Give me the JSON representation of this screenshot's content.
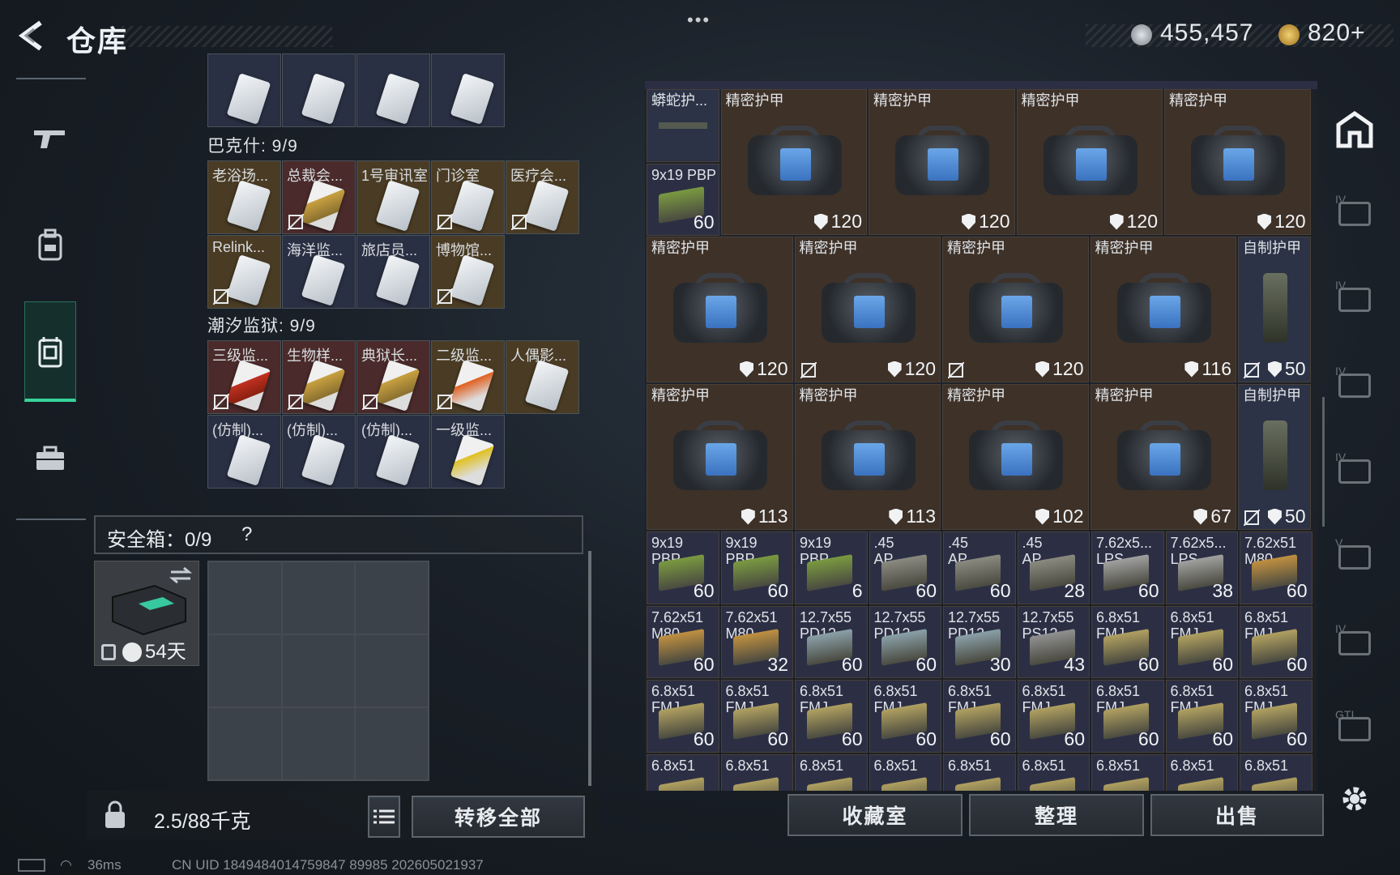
{
  "header": {
    "title": "仓库",
    "menu_dots": "•••",
    "currency1": "455,457",
    "currency2": "820+"
  },
  "left_nav": {
    "items": [
      "weapon-icon",
      "backpack-icon",
      "vest-icon",
      "briefcase-icon"
    ]
  },
  "keycards": {
    "top_row": [
      {
        "label": "",
        "color": "blue"
      },
      {
        "label": "",
        "color": "blue"
      },
      {
        "label": "",
        "color": "blue"
      },
      {
        "label": "",
        "color": "blue"
      }
    ],
    "section1": {
      "title": "巴克什: 9/9",
      "items": [
        {
          "label": "老浴场...",
          "bg": "gold",
          "card": "white",
          "locked": false
        },
        {
          "label": "总裁会...",
          "bg": "red",
          "card": "gold",
          "locked": true
        },
        {
          "label": "1号审讯室",
          "bg": "gold",
          "card": "white",
          "locked": false
        },
        {
          "label": "门诊室",
          "bg": "gold",
          "card": "white",
          "locked": true
        },
        {
          "label": "医疗会...",
          "bg": "gold",
          "card": "white",
          "locked": true
        },
        {
          "label": "Relink...",
          "bg": "gold",
          "card": "white",
          "locked": true
        },
        {
          "label": "海洋监...",
          "bg": "blue",
          "card": "white",
          "locked": false
        },
        {
          "label": "旅店员...",
          "bg": "blue",
          "card": "white",
          "locked": false
        },
        {
          "label": "博物馆...",
          "bg": "gold",
          "card": "white",
          "locked": true
        }
      ]
    },
    "section2": {
      "title": "潮汐监狱: 9/9",
      "items": [
        {
          "label": "三级监...",
          "bg": "red",
          "card": "red",
          "locked": true
        },
        {
          "label": "生物样...",
          "bg": "red",
          "card": "gold",
          "locked": true
        },
        {
          "label": "典狱长...",
          "bg": "red",
          "card": "gold",
          "locked": true
        },
        {
          "label": "二级监...",
          "bg": "gold",
          "card": "orange",
          "locked": true
        },
        {
          "label": "人偶影...",
          "bg": "gold",
          "card": "white",
          "locked": false
        },
        {
          "label": "(仿制)...",
          "bg": "blue",
          "card": "white",
          "locked": false
        },
        {
          "label": "(仿制)...",
          "bg": "blue",
          "card": "white",
          "locked": false
        },
        {
          "label": "(仿制)...",
          "bg": "blue",
          "card": "white",
          "locked": false
        },
        {
          "label": "一级监...",
          "bg": "blue",
          "card": "yellow",
          "locked": false
        }
      ]
    }
  },
  "safebox": {
    "label": "安全箱：0/9",
    "help": "?",
    "days": "54天"
  },
  "bottom_left": {
    "weight": "2.5/88千克",
    "transfer_all": "转移全部"
  },
  "inventory": {
    "row1": [
      {
        "name": "蟒蛇护...",
        "type": "rig"
      },
      {
        "name": "精密护甲",
        "dur": "120"
      },
      {
        "name": "精密护甲",
        "dur": "120"
      },
      {
        "name": "精密护甲",
        "dur": "120"
      },
      {
        "name": "精密护甲",
        "dur": "120"
      }
    ],
    "row1_ammo": {
      "name": "9x19 PBP",
      "qty": "60"
    },
    "row2": [
      {
        "name": "精密护甲",
        "dur": "120",
        "lock": false
      },
      {
        "name": "精密护甲",
        "dur": "120",
        "lock": true
      },
      {
        "name": "精密护甲",
        "dur": "120",
        "lock": true
      },
      {
        "name": "精密护甲",
        "dur": "116",
        "lock": false
      },
      {
        "name": "自制护甲",
        "dur": "50",
        "lock": true
      }
    ],
    "row3": [
      {
        "name": "精密护甲",
        "dur": "113",
        "lock": false
      },
      {
        "name": "精密护甲",
        "dur": "113",
        "lock": false
      },
      {
        "name": "精密护甲",
        "dur": "102",
        "lock": false
      },
      {
        "name": "精密护甲",
        "dur": "67",
        "lock": false
      },
      {
        "name": "自制护甲",
        "dur": "50",
        "lock": true
      }
    ],
    "ammo_rows": [
      [
        {
          "n1": "9x19",
          "n2": "PBP",
          "q": "60",
          "c": "#7a9a40"
        },
        {
          "n1": "9x19",
          "n2": "PBP",
          "q": "60",
          "c": "#7a9a40"
        },
        {
          "n1": "9x19",
          "n2": "PBP",
          "q": "6",
          "c": "#7a9a40"
        },
        {
          "n1": ".45",
          "n2": "AP",
          "q": "60",
          "c": "#8a8a80"
        },
        {
          "n1": ".45",
          "n2": "AP",
          "q": "60",
          "c": "#8a8a80"
        },
        {
          "n1": ".45",
          "n2": "AP",
          "q": "28",
          "c": "#8a8a80"
        },
        {
          "n1": "7.62x5...",
          "n2": "LPS",
          "q": "60",
          "c": "#a0a0a0"
        },
        {
          "n1": "7.62x5...",
          "n2": "LPS",
          "q": "38",
          "c": "#a0a0a0"
        },
        {
          "n1": "7.62x51",
          "n2": "M80",
          "q": "60",
          "c": "#c09040"
        }
      ],
      [
        {
          "n1": "7.62x51",
          "n2": "M80",
          "q": "60",
          "c": "#c09040"
        },
        {
          "n1": "7.62x51",
          "n2": "M80",
          "q": "32",
          "c": "#c09040"
        },
        {
          "n1": "12.7x55",
          "n2": "PD12",
          "q": "60",
          "c": "#8aa0a8"
        },
        {
          "n1": "12.7x55",
          "n2": "PD12",
          "q": "60",
          "c": "#8aa0a8"
        },
        {
          "n1": "12.7x55",
          "n2": "PD12",
          "q": "30",
          "c": "#8aa0a8"
        },
        {
          "n1": "12.7x55",
          "n2": "PS12",
          "q": "43",
          "c": "#909090"
        },
        {
          "n1": "6.8x51",
          "n2": "FMJ",
          "q": "60",
          "c": "#b0a060"
        },
        {
          "n1": "6.8x51",
          "n2": "FMJ",
          "q": "60",
          "c": "#b0a060"
        },
        {
          "n1": "6.8x51",
          "n2": "FMJ",
          "q": "60",
          "c": "#b0a060"
        }
      ],
      [
        {
          "n1": "6.8x51",
          "n2": "FMJ",
          "q": "60",
          "c": "#b0a060"
        },
        {
          "n1": "6.8x51",
          "n2": "FMJ",
          "q": "60",
          "c": "#b0a060"
        },
        {
          "n1": "6.8x51",
          "n2": "FMJ",
          "q": "60",
          "c": "#b0a060"
        },
        {
          "n1": "6.8x51",
          "n2": "FMJ",
          "q": "60",
          "c": "#b0a060"
        },
        {
          "n1": "6.8x51",
          "n2": "FMJ",
          "q": "60",
          "c": "#b0a060"
        },
        {
          "n1": "6.8x51",
          "n2": "FMJ",
          "q": "60",
          "c": "#b0a060"
        },
        {
          "n1": "6.8x51",
          "n2": "FMJ",
          "q": "60",
          "c": "#b0a060"
        },
        {
          "n1": "6.8x51",
          "n2": "FMJ",
          "q": "60",
          "c": "#b0a060"
        },
        {
          "n1": "6.8x51",
          "n2": "FMJ",
          "q": "60",
          "c": "#b0a060"
        }
      ],
      [
        {
          "n1": "6.8x51",
          "n2": "",
          "q": "",
          "c": "#b0a060"
        },
        {
          "n1": "6.8x51",
          "n2": "",
          "q": "",
          "c": "#b0a060"
        },
        {
          "n1": "6.8x51",
          "n2": "",
          "q": "",
          "c": "#b0a060"
        },
        {
          "n1": "6.8x51",
          "n2": "",
          "q": "",
          "c": "#b0a060"
        },
        {
          "n1": "6.8x51",
          "n2": "",
          "q": "",
          "c": "#b0a060"
        },
        {
          "n1": "6.8x51",
          "n2": "",
          "q": "",
          "c": "#b0a060"
        },
        {
          "n1": "6.8x51",
          "n2": "",
          "q": "",
          "c": "#b0a060"
        },
        {
          "n1": "6.8x51",
          "n2": "",
          "q": "",
          "c": "#b0a060"
        },
        {
          "n1": "6.8x51",
          "n2": "",
          "q": "",
          "c": "#b0a060"
        }
      ]
    ]
  },
  "bottom_right": {
    "collection": "收藏室",
    "sort": "整理",
    "sell": "出售"
  },
  "right_nav": {
    "tabs": [
      "IV",
      "IV",
      "IV",
      "IV",
      "V",
      "IV",
      "GTI"
    ]
  },
  "status": {
    "ping": "36ms",
    "uid": "CN UID 1849484014759847 89985 202605021937"
  }
}
